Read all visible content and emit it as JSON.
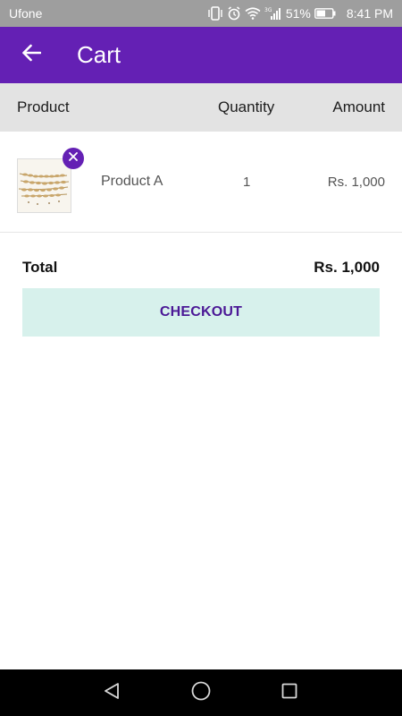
{
  "status_bar": {
    "carrier": "Ufone",
    "network_label": "3G",
    "battery_percent": "51%",
    "time": "8:41 PM",
    "icons": [
      "vibrate-icon",
      "alarm-icon",
      "wifi-icon",
      "signal-icon",
      "battery-icon"
    ]
  },
  "app_bar": {
    "title": "Cart",
    "back_icon": "arrow-left-icon",
    "background_color": "#6420b4"
  },
  "table": {
    "headers": {
      "product": "Product",
      "quantity": "Quantity",
      "amount": "Amount"
    },
    "rows": [
      {
        "name": "Product A",
        "quantity": "1",
        "amount": "Rs. 1,000",
        "image_icon": "wheat-image",
        "remove_icon": "close-icon"
      }
    ]
  },
  "summary": {
    "total_label": "Total",
    "total_value": "Rs. 1,000"
  },
  "checkout": {
    "label": "CHECKOUT",
    "background_color": "#d7f1ec",
    "text_color": "#4b1896"
  },
  "nav_bar": {
    "icons": [
      "back-triangle-icon",
      "home-circle-icon",
      "recent-square-icon"
    ]
  }
}
